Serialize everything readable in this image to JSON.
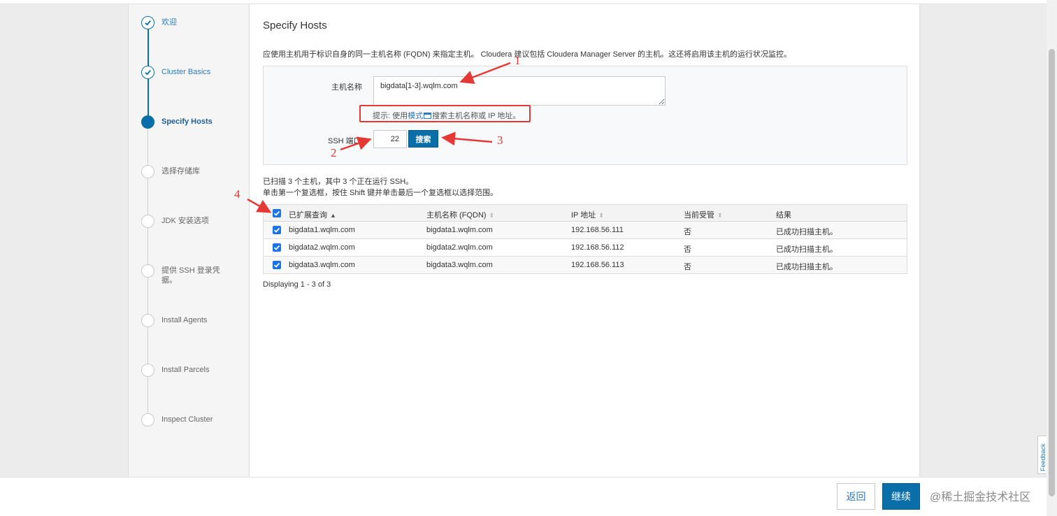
{
  "steps": [
    {
      "label": "欢迎",
      "state": "done"
    },
    {
      "label": "Cluster Basics",
      "state": "done"
    },
    {
      "label": "Specify Hosts",
      "state": "active"
    },
    {
      "label": "选择存储库",
      "state": "todo"
    },
    {
      "label": "JDK 安装选项",
      "state": "todo"
    },
    {
      "label": "提供 SSH 登录凭据。",
      "state": "todo"
    },
    {
      "label": "Install Agents",
      "state": "todo"
    },
    {
      "label": "Install Parcels",
      "state": "todo"
    },
    {
      "label": "Inspect Cluster",
      "state": "todo"
    }
  ],
  "page": {
    "title": "Specify Hosts",
    "intro": "应使用主机用于标识自身的同一主机名称 (FQDN) 来指定主机。 Cloudera 建议包括 Cloudera Manager Server 的主机。这还将启用该主机的运行状况监控。"
  },
  "form": {
    "host_label": "主机名称",
    "host_value": "bigdata[1-3].wqlm.com",
    "hint_prefix": "提示: 使用",
    "hint_link": "模式",
    "hint_suffix": "搜索主机名称或 IP 地址。",
    "ssh_label": "SSH 端口:",
    "ssh_value": "22",
    "search_label": "搜索"
  },
  "scan": {
    "line1": "已扫描 3 个主机，其中 3 个正在运行 SSH。",
    "line2": "单击第一个复选框，按住 Shift 键并单击最后一个复选框以选择范围。"
  },
  "table": {
    "headers": [
      "已扩展查询",
      "主机名称 (FQDN)",
      "IP 地址",
      "当前受管",
      "结果"
    ],
    "rows": [
      [
        "bigdata1.wqlm.com",
        "bigdata1.wqlm.com",
        "192.168.56.111",
        "否",
        "已成功扫描主机。"
      ],
      [
        "bigdata2.wqlm.com",
        "bigdata2.wqlm.com",
        "192.168.56.112",
        "否",
        "已成功扫描主机。"
      ],
      [
        "bigdata3.wqlm.com",
        "bigdata3.wqlm.com",
        "192.168.56.113",
        "否",
        "已成功扫描主机。"
      ]
    ],
    "displaying": "Displaying 1 - 3 of 3"
  },
  "annotations": [
    "1",
    "2",
    "3",
    "4"
  ],
  "footer": {
    "back_label": "返回",
    "next_label": "继续",
    "watermark": "@稀土掘金技术社区"
  },
  "feedback_label": "Feedback",
  "colors": {
    "accent": "#0a6ea8",
    "annotation": "#e53935",
    "checkbox": "#1a73e8"
  }
}
